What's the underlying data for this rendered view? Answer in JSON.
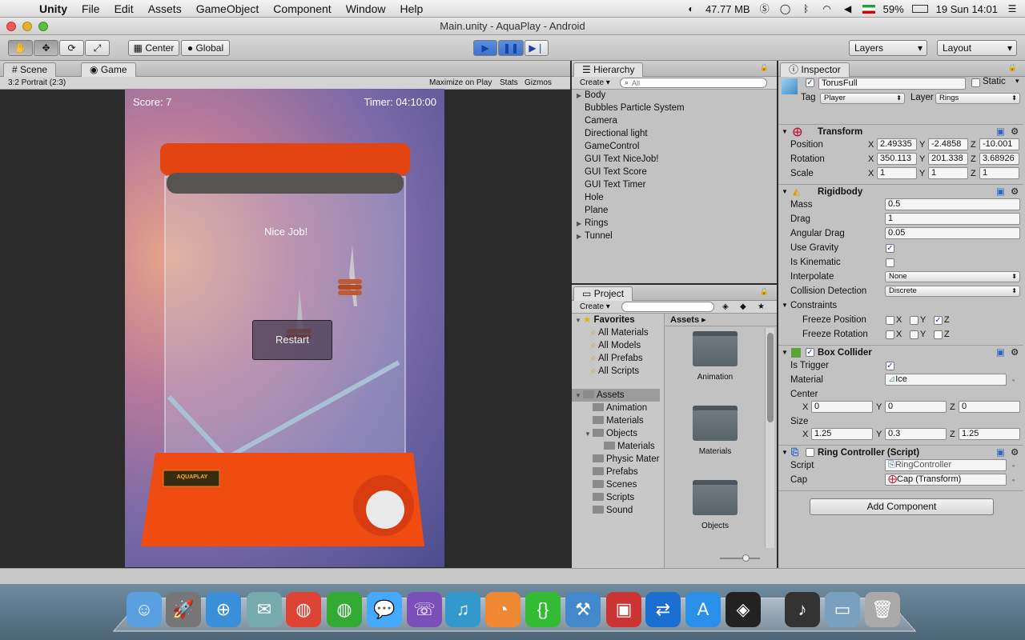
{
  "menubar": {
    "app": "Unity",
    "items": [
      "File",
      "Edit",
      "Assets",
      "GameObject",
      "Component",
      "Window",
      "Help"
    ],
    "memory": "47.77 MB",
    "battery": "59%",
    "clock": "19 Sun 14:01"
  },
  "window": {
    "title": "Main.unity - AquaPlay - Android"
  },
  "toolbar": {
    "pivot": "Center",
    "space": "Global",
    "layers": "Layers",
    "layout": "Layout"
  },
  "scene_panel": {
    "tabs": [
      "Scene",
      "Game"
    ],
    "aspect": "3:2 Portrait (2:3)",
    "buttons": [
      "Maximize on Play",
      "Stats",
      "Gizmos"
    ]
  },
  "game": {
    "score": "Score: 7",
    "timer": "Timer: 04:10:00",
    "message": "Nice Job!",
    "restart": "Restart",
    "brand": "AQUAPLAY"
  },
  "hierarchy": {
    "title": "Hierarchy",
    "create": "Create",
    "search_placeholder": "All",
    "items": [
      {
        "label": "Body",
        "expand": true
      },
      {
        "label": "Bubbles Particle System",
        "expand": false
      },
      {
        "label": "Camera",
        "expand": false
      },
      {
        "label": "Directional light",
        "expand": false
      },
      {
        "label": "GameControl",
        "expand": false
      },
      {
        "label": "GUI Text NiceJob!",
        "expand": false
      },
      {
        "label": "GUI Text Score",
        "expand": false
      },
      {
        "label": "GUI Text Timer",
        "expand": false
      },
      {
        "label": "Hole",
        "expand": false
      },
      {
        "label": "Plane",
        "expand": false
      },
      {
        "label": "Rings",
        "expand": true
      },
      {
        "label": "Tunnel",
        "expand": true
      }
    ]
  },
  "project": {
    "title": "Project",
    "create": "Create",
    "favorites": "Favorites",
    "fav_items": [
      "All Materials",
      "All Models",
      "All Prefabs",
      "All Scripts"
    ],
    "assets_root": "Assets",
    "breadcrumb": "Assets",
    "tree": [
      {
        "label": "Animation",
        "indent": 1
      },
      {
        "label": "Materials",
        "indent": 1
      },
      {
        "label": "Objects",
        "indent": 1
      },
      {
        "label": "Materials",
        "indent": 2
      },
      {
        "label": "Physic Mater",
        "indent": 1
      },
      {
        "label": "Prefabs",
        "indent": 1
      },
      {
        "label": "Scenes",
        "indent": 1
      },
      {
        "label": "Scripts",
        "indent": 1
      },
      {
        "label": "Sound",
        "indent": 1
      }
    ],
    "grid": [
      "Animation",
      "Materials",
      "Objects"
    ]
  },
  "inspector": {
    "title": "Inspector",
    "object_name": "TorusFull",
    "static": "Static",
    "tag_label": "Tag",
    "tag": "Player",
    "layer_label": "Layer",
    "layer": "Rings",
    "transform": {
      "title": "Transform",
      "position": [
        "2.49335",
        "-2.4858",
        "-10.001"
      ],
      "rotation": [
        "350.113",
        "201.338",
        "3.68926"
      ],
      "scale": [
        "1",
        "1",
        "1"
      ],
      "labels": [
        "Position",
        "Rotation",
        "Scale"
      ]
    },
    "rigidbody": {
      "title": "Rigidbody",
      "mass_label": "Mass",
      "mass": "0.5",
      "drag_label": "Drag",
      "drag": "1",
      "adrag_label": "Angular Drag",
      "adrag": "0.05",
      "gravity_label": "Use Gravity",
      "gravity": true,
      "kinematic_label": "Is Kinematic",
      "kinematic": false,
      "interp_label": "Interpolate",
      "interp": "None",
      "cd_label": "Collision Detection",
      "cd": "Discrete",
      "constraints": "Constraints",
      "fp": "Freeze Position",
      "fr": "Freeze Rotation",
      "freeze_position": [
        false,
        false,
        true
      ],
      "freeze_rotation": [
        false,
        false,
        false
      ]
    },
    "box": {
      "title": "Box Collider",
      "trigger_label": "Is Trigger",
      "trigger": true,
      "material_label": "Material",
      "material": "Ice",
      "center_label": "Center",
      "center": [
        "0",
        "0",
        "0"
      ],
      "size_label": "Size",
      "size": [
        "1.25",
        "0.3",
        "1.25"
      ]
    },
    "script": {
      "title": "Ring Controller (Script)",
      "script_label": "Script",
      "script": "RingController",
      "cap_label": "Cap",
      "cap": "Cap (Transform)"
    },
    "add_component": "Add Component"
  },
  "axes": [
    "X",
    "Y",
    "Z"
  ],
  "colors": {
    "accent": "#2f64c8",
    "toy": "#ef4a12",
    "bg": "#2b2b2b"
  }
}
